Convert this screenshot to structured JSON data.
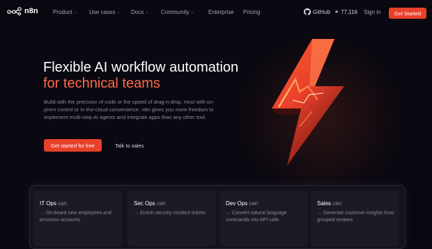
{
  "nav": {
    "logo_text": "n8n",
    "items": [
      {
        "label": "Product"
      },
      {
        "label": "Use cases"
      },
      {
        "label": "Docs"
      },
      {
        "label": "Community"
      },
      {
        "label": "Enterprise"
      },
      {
        "label": "Pricing"
      }
    ],
    "github_label": "GitHub",
    "github_stars": "77,116",
    "signin_label": "Sign in",
    "get_started_label": "Get Started"
  },
  "hero": {
    "title_line1": "Flexible AI workflow automation",
    "title_line2": "for technical teams",
    "subtitle": "Build with the precision of code or the speed of drag-n-drop. Host with on-prem control or in-the-cloud convenience. n8n gives you more freedom to implement multi-step AI agents and integrate apps than any other tool.",
    "cta_primary": "Get started for free",
    "cta_secondary": "Talk to sales"
  },
  "cards": [
    {
      "role": "IT Ops",
      "can": "can",
      "desc": "→ On-board new employees and provision accounts"
    },
    {
      "role": "Sec Ops",
      "can": "can",
      "desc": "→ Enrich security incident tickets"
    },
    {
      "role": "Dev Ops",
      "can": "can",
      "desc": "→ Convert natural language commands into API calls"
    },
    {
      "role": "Sales",
      "can": "can",
      "desc": "→ Generate customer insights from grouped reviews"
    }
  ],
  "colors": {
    "accent": "#e8412a",
    "highlight": "#ff6b4a",
    "background": "#0a0810"
  },
  "icons": [
    "n8n-logo-icon",
    "chevron-down-icon",
    "github-icon",
    "star-icon",
    "lightning-bolt-icon"
  ]
}
